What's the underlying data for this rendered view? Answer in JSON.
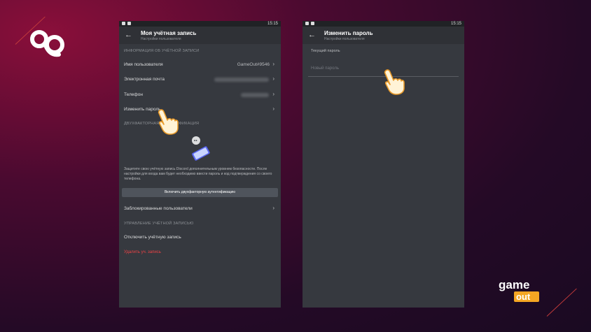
{
  "brand": {
    "logo_left_icon": "circular-logo-icon",
    "logo_right_text": "game out",
    "line_color": "#c23a3a"
  },
  "left_screen": {
    "status_time": "15:15",
    "title": "Моя учётная запись",
    "subtitle": "Настройки пользователя",
    "section_account": "ИНФОРМАЦИЯ ОБ УЧЁТНОЙ ЗАПИСИ",
    "rows": {
      "username": {
        "label": "Имя пользователя",
        "value": "GameOut#9546"
      },
      "email": {
        "label": "Электронная почта"
      },
      "phone": {
        "label": "Телефон"
      },
      "password": {
        "label": "Изменить пароль"
      }
    },
    "section_2fa": "ДВУХФАКТОРНАЯ АУТЕНТИФИКАЦИЯ",
    "twofa_description": "Защитите свою учётную запись Discord дополнительным уровнем безопасности. После настройки для входа вам будет необходимо ввести пароль и код подтверждения со своего телефона.",
    "twofa_button": "Включить двухфакторную аутентификацию",
    "blocked_users": "Заблокированные пользователи",
    "section_management": "УПРАВЛЕНИЕ УЧЁТНОЙ ЗАПИСЬЮ",
    "disable_account": "Отключить учётную запись",
    "delete_account": "Удалить уч. запись",
    "delete_color": "#ed4245"
  },
  "right_screen": {
    "status_time": "15:15",
    "title": "Изменить пароль",
    "subtitle": "Настройки пользователя",
    "current_password_label": "Текущий пароль",
    "new_password_placeholder": "Новый пароль"
  },
  "colors": {
    "panel": "#36393f",
    "topbar": "#2f3136",
    "statusbar": "#202225"
  }
}
